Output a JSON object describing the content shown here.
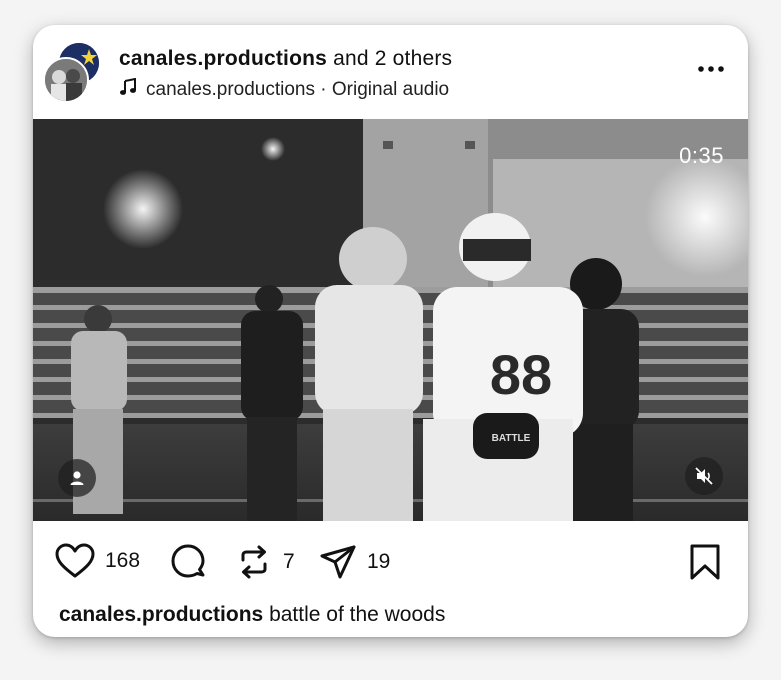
{
  "post": {
    "author": "canales.productions",
    "coauthors": "and 2 others",
    "audio_label": "canales.productions · Original audio",
    "duration": "0:35",
    "likes": "168",
    "reposts": "7",
    "shares": "19",
    "caption_user": "canales.productions",
    "caption_text": "battle of the woods",
    "jersey_number": "88",
    "belt_label": "BATTLE"
  },
  "icons": {
    "more": "more-horizontal-icon",
    "music": "music-note-icon",
    "like": "heart-icon",
    "comment": "comment-icon",
    "repost": "repost-icon",
    "share": "send-icon",
    "save": "bookmark-icon",
    "tag": "person-tag-icon",
    "mute": "speaker-muted-icon"
  },
  "colors": {
    "background": "#f4f4f4",
    "card": "#ffffff",
    "text": "#111111"
  }
}
